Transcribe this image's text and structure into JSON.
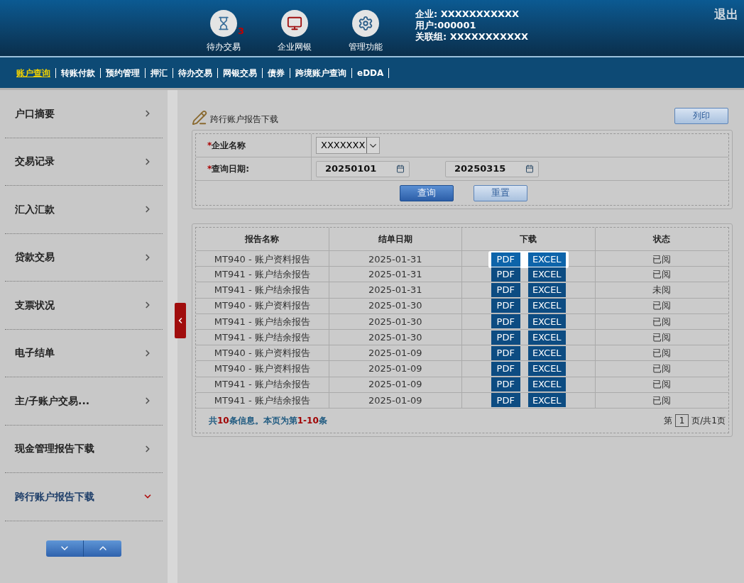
{
  "header": {
    "shortcuts": [
      {
        "kind": "pending",
        "label": "待办交易",
        "badge": "3"
      },
      {
        "kind": "ebank",
        "label": "企业网银"
      },
      {
        "kind": "admin",
        "label": "管理功能"
      }
    ],
    "info": [
      "企业: XXXXXXXXXXX",
      "用户:000001",
      "关联组: XXXXXXXXXXX"
    ],
    "logout": "退出"
  },
  "nav": [
    {
      "label": "账户查询",
      "selected": true
    },
    {
      "label": "转账付款",
      "selected": false
    },
    {
      "label": "预约管理",
      "selected": false
    },
    {
      "label": "押汇",
      "selected": false
    },
    {
      "label": "待办交易",
      "selected": false
    },
    {
      "label": "网银交易",
      "selected": false
    },
    {
      "label": "债券",
      "selected": false
    },
    {
      "label": "跨境账户查询",
      "selected": false
    },
    {
      "label": "eDDA",
      "selected": false
    }
  ],
  "sidebar": {
    "items": [
      {
        "label": "户口摘要",
        "selected": false
      },
      {
        "label": "交易记录",
        "selected": false
      },
      {
        "label": "汇入汇款",
        "selected": false
      },
      {
        "label": "贷款交易",
        "selected": false
      },
      {
        "label": "支票状况",
        "selected": false
      },
      {
        "label": "电子结单",
        "selected": false
      },
      {
        "label": "主/子账户交易...",
        "selected": false
      },
      {
        "label": "现金管理报告下载",
        "selected": false
      },
      {
        "label": "跨行账户报告下载",
        "selected": true
      }
    ]
  },
  "page": {
    "title": "跨行账户报告下载",
    "print_button": "列印"
  },
  "form": {
    "company": {
      "label": "企业名称",
      "required": "*",
      "value": "XXXXXXX"
    },
    "date": {
      "label": "查询日期:",
      "required": "*",
      "from": "20250101",
      "to": "20250315"
    },
    "buttons": {
      "search": "查询",
      "reset": "重置"
    }
  },
  "table": {
    "columns": [
      "报告名称",
      "结单日期",
      "下载",
      "状态"
    ],
    "rows": [
      {
        "name": "MT940 - 账户资料报告",
        "date": "2025-01-31",
        "pdf": "PDF",
        "excel": "EXCEL",
        "status": "已阅",
        "highlighted": true
      },
      {
        "name": "MT941 - 账户结余报告",
        "date": "2025-01-31",
        "pdf": "PDF",
        "excel": "EXCEL",
        "status": "已阅",
        "highlighted": false
      },
      {
        "name": "MT941 - 账户结余报告",
        "date": "2025-01-31",
        "pdf": "PDF",
        "excel": "EXCEL",
        "status": "未阅",
        "highlighted": false
      },
      {
        "name": "MT940 - 账户资料报告",
        "date": "2025-01-30",
        "pdf": "PDF",
        "excel": "EXCEL",
        "status": "已阅",
        "highlighted": false
      },
      {
        "name": "MT941 - 账户结余报告",
        "date": "2025-01-30",
        "pdf": "PDF",
        "excel": "EXCEL",
        "status": "已阅",
        "highlighted": false
      },
      {
        "name": "MT941 - 账户结余报告",
        "date": "2025-01-30",
        "pdf": "PDF",
        "excel": "EXCEL",
        "status": "已阅",
        "highlighted": false
      },
      {
        "name": "MT940 - 账户资料报告",
        "date": "2025-01-09",
        "pdf": "PDF",
        "excel": "EXCEL",
        "status": "已阅",
        "highlighted": false
      },
      {
        "name": "MT940 - 账户资料报告",
        "date": "2025-01-09",
        "pdf": "PDF",
        "excel": "EXCEL",
        "status": "已阅",
        "highlighted": false
      },
      {
        "name": "MT941 - 账户结余报告",
        "date": "2025-01-09",
        "pdf": "PDF",
        "excel": "EXCEL",
        "status": "已阅",
        "highlighted": false
      },
      {
        "name": "MT941 - 账户结余报告",
        "date": "2025-01-09",
        "pdf": "PDF",
        "excel": "EXCEL",
        "status": "已阅",
        "highlighted": false
      }
    ],
    "summary": "共**10**条信息。本页为第**1-10**条",
    "pager": {
      "prefix": "第",
      "page": "1",
      "suffix": "页/共1页"
    }
  }
}
